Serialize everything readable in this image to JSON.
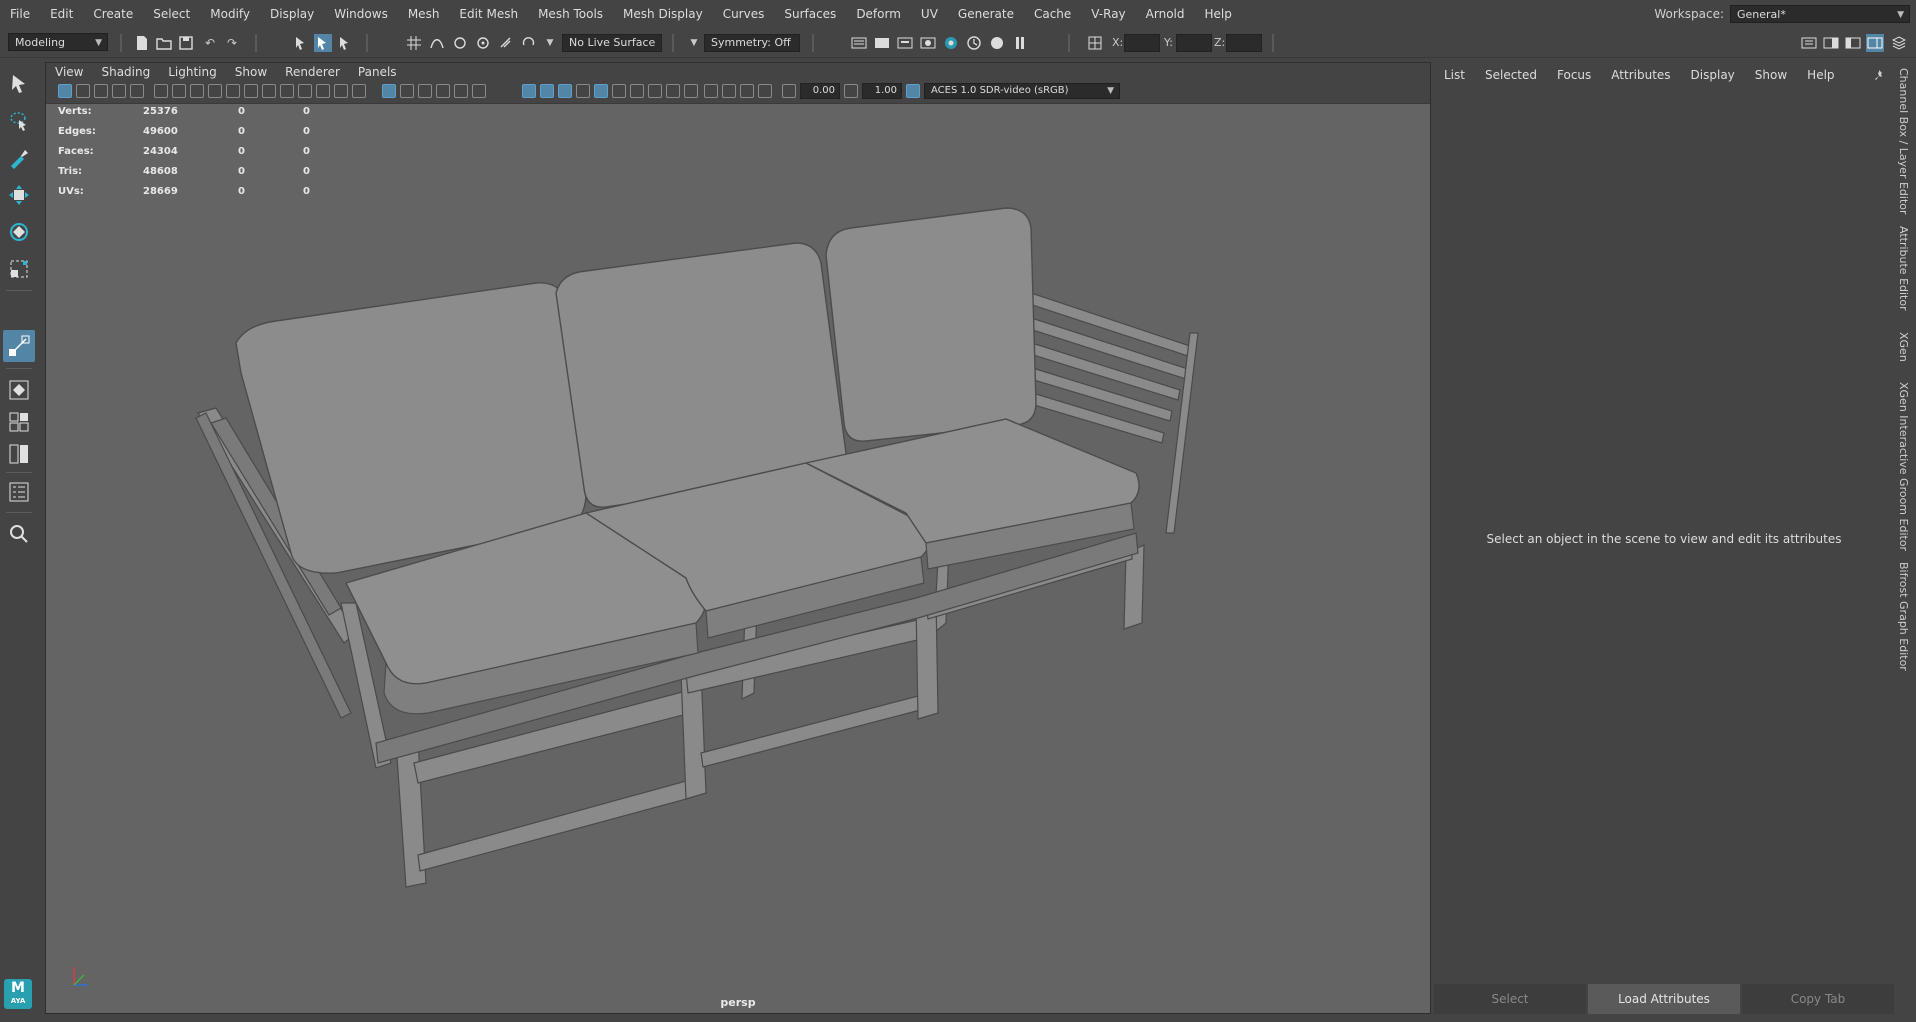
{
  "menubar": {
    "items": [
      "File",
      "Edit",
      "Create",
      "Select",
      "Modify",
      "Display",
      "Windows",
      "Mesh",
      "Edit Mesh",
      "Mesh Tools",
      "Mesh Display",
      "Curves",
      "Surfaces",
      "Deform",
      "UV",
      "Generate",
      "Cache",
      "V-Ray",
      "Arnold",
      "Help"
    ]
  },
  "workspace": {
    "label": "Workspace:",
    "value": "General*"
  },
  "shelf": {
    "mode": "Modeling",
    "live_surface": "No Live Surface",
    "symmetry": "Symmetry: Off",
    "coords": {
      "x_label": "X:",
      "y_label": "Y:",
      "z_label": "Z:"
    }
  },
  "viewport": {
    "menu": [
      "View",
      "Shading",
      "Lighting",
      "Show",
      "Renderer",
      "Panels"
    ],
    "exposure": "0.00",
    "gamma": "1.00",
    "color_space": "ACES 1.0 SDR-video (sRGB)",
    "hud": [
      {
        "label": "Verts:",
        "total": "25376",
        "sel": "0",
        "comp": "0"
      },
      {
        "label": "Edges:",
        "total": "49600",
        "sel": "0",
        "comp": "0"
      },
      {
        "label": "Faces:",
        "total": "24304",
        "sel": "0",
        "comp": "0"
      },
      {
        "label": "Tris:",
        "total": "48608",
        "sel": "0",
        "comp": "0"
      },
      {
        "label": "UVs:",
        "total": "28669",
        "sel": "0",
        "comp": "0"
      }
    ],
    "camera": "persp"
  },
  "attribute_panel": {
    "menu": [
      "List",
      "Selected",
      "Focus",
      "Attributes",
      "Display",
      "Show",
      "Help"
    ],
    "message": "Select an object in the scene to view and edit its attributes",
    "buttons": [
      "Select",
      "Load Attributes",
      "Copy Tab"
    ]
  },
  "side_tabs": [
    "Channel Box / Layer Editor",
    "Attribute Editor",
    "XGen",
    "XGen Interactive Groom Editor",
    "Bifrost Graph Editor"
  ],
  "badge": {
    "letter": "M",
    "sub": "AYA"
  }
}
